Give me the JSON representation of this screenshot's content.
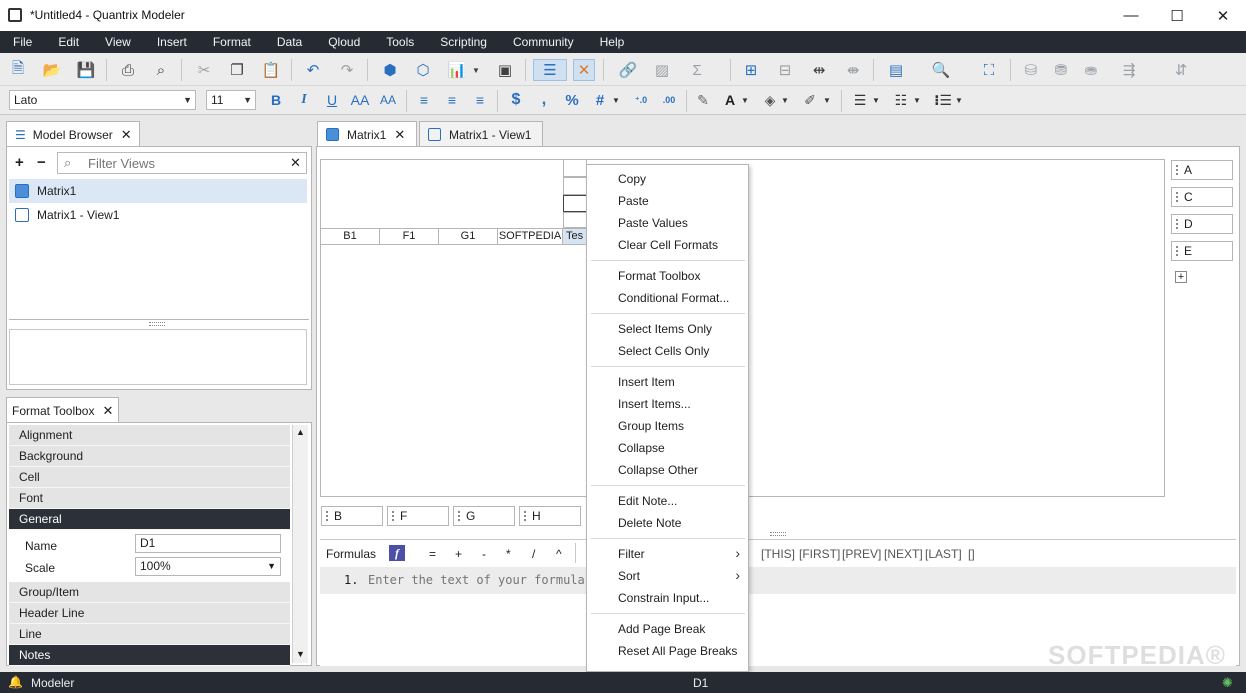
{
  "window": {
    "title": "*Untitled4 - Quantrix Modeler",
    "minimize": "—",
    "maximize": "☐",
    "close": "✕"
  },
  "menu": [
    "File",
    "Edit",
    "View",
    "Insert",
    "Format",
    "Data",
    "Qloud",
    "Tools",
    "Scripting",
    "Community",
    "Help"
  ],
  "format_bar": {
    "font": "Lato",
    "size": "11",
    "bold": "B",
    "italic": "I",
    "underline": "U",
    "grow": "AA",
    "shrink": "AA",
    "currency": "$",
    "comma": ",",
    "percent": "%",
    "number": "#"
  },
  "model_browser": {
    "tab_label": "Model Browser",
    "add": "+",
    "remove": "−",
    "filter_placeholder": "Filter Views",
    "items": [
      {
        "label": "Matrix1",
        "selected": true
      },
      {
        "label": "Matrix1 - View1",
        "selected": false
      }
    ]
  },
  "format_toolbox": {
    "tab_label": "Format Toolbox",
    "sections_top": [
      "Alignment",
      "Background",
      "Cell",
      "Font"
    ],
    "general_label": "General",
    "name_label": "Name",
    "name_value": "D1",
    "scale_label": "Scale",
    "scale_value": "100%",
    "sections_bottom": [
      "Group/Item",
      "Header Line",
      "Line",
      "Notes"
    ]
  },
  "doc_tabs": [
    {
      "label": "Matrix1",
      "active": true
    },
    {
      "label": "Matrix1 - View1",
      "active": false
    }
  ],
  "grid": {
    "headers": [
      "B1",
      "F1",
      "G1",
      "SOFTPEDIA",
      "Tes"
    ]
  },
  "right_tiles": [
    "A",
    "C",
    "D",
    "E"
  ],
  "right_add": "+",
  "bottom_tiles": [
    "B",
    "F",
    "G",
    "H"
  ],
  "formulas": {
    "label": "Formulas",
    "fx": "f",
    "ops": [
      "=",
      "+",
      "-",
      "*",
      "/",
      "^"
    ],
    "refs": [
      "[THIS]",
      "[FIRST]",
      "[PREV]",
      "[NEXT]",
      "[LAST]",
      "[]"
    ],
    "line_number": "1.",
    "placeholder": "Enter the text of your formula"
  },
  "context_menu": {
    "items": [
      {
        "label": "Copy",
        "y": 0
      },
      {
        "label": "Paste",
        "y": 0
      },
      {
        "label": "Paste Values",
        "y": 0
      },
      {
        "label": "Clear Cell Formats",
        "y": 0
      },
      {
        "label": "Format Toolbox",
        "y": 0
      },
      {
        "label": "Conditional Format...",
        "y": 0
      },
      {
        "label": "Select Items Only",
        "y": 0
      },
      {
        "label": "Select Cells Only",
        "y": 0
      },
      {
        "label": "Insert Item",
        "y": 0
      },
      {
        "label": "Insert Items...",
        "y": 0
      },
      {
        "label": "Group Items",
        "y": 0
      },
      {
        "label": "Collapse",
        "y": 0
      },
      {
        "label": "Collapse Other",
        "y": 0
      },
      {
        "label": "Edit Note...",
        "y": 0
      },
      {
        "label": "Delete Note",
        "y": 0
      },
      {
        "label": "Filter",
        "y": 0
      },
      {
        "label": "Sort",
        "y": 0
      },
      {
        "label": "Constrain Input...",
        "y": 0
      },
      {
        "label": "Add Page Break",
        "y": 0
      },
      {
        "label": "Reset All Page Breaks",
        "y": 0
      }
    ],
    "submenu_arrow": "›"
  },
  "status": {
    "mode": "Modeler",
    "cell": "D1"
  },
  "watermark": "SOFTPEDIA®"
}
